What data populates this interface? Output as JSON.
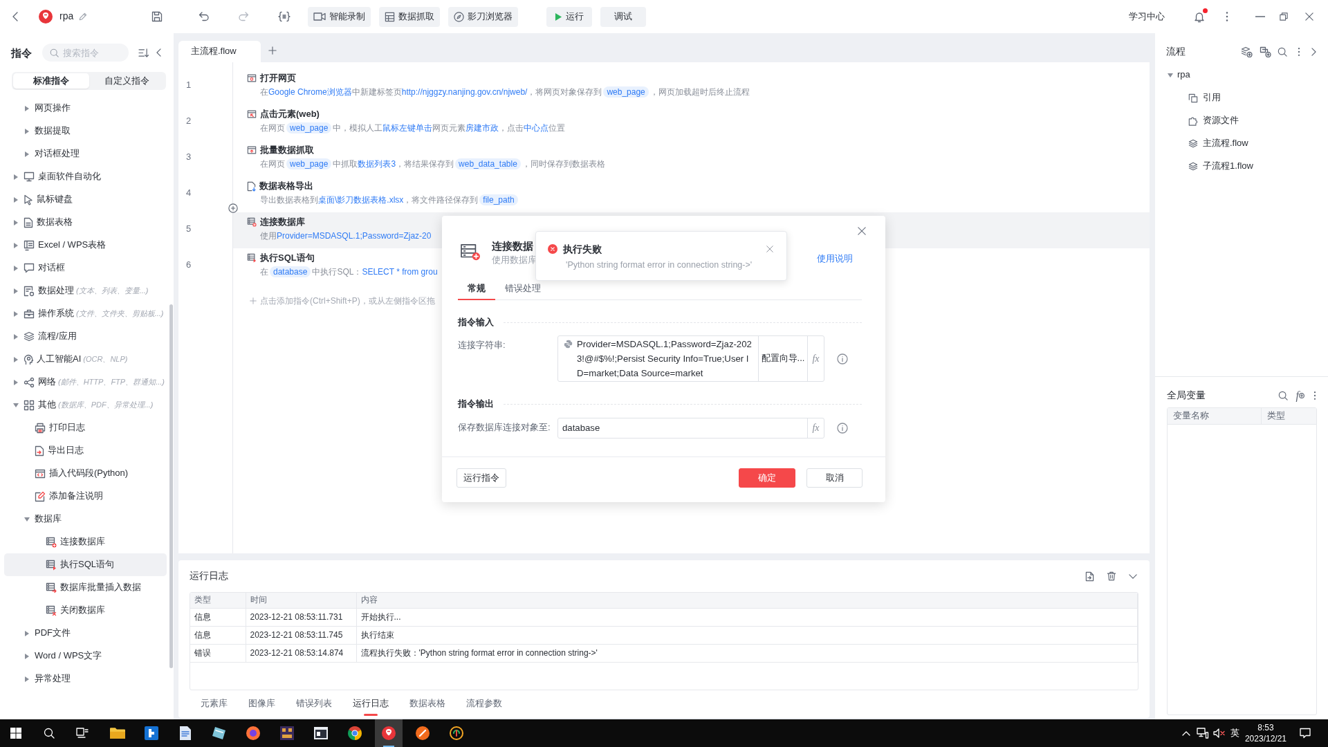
{
  "title_bar": {
    "project_name": "rpa",
    "toolbar_buttons": [
      {
        "label": "智能录制"
      },
      {
        "label": "数据抓取"
      },
      {
        "label": "影刀浏览器"
      },
      {
        "label": "运行"
      },
      {
        "label": "调试"
      }
    ],
    "learning_center": "学习中心",
    "notification": {
      "unread": true
    }
  },
  "commands_panel": {
    "title": "指令",
    "search": {
      "placeholder": "搜索指令"
    },
    "tabs": [
      {
        "label": "标准指令",
        "selected": true
      },
      {
        "label": "自定义指令",
        "selected": false
      }
    ],
    "tree": [
      {
        "children": [
          {
            "kind": "group",
            "label": "网页操作",
            "expanded": false,
            "selected": false
          },
          {
            "kind": "group",
            "label": "数据提取",
            "expanded": false,
            "selected": false
          },
          {
            "kind": "group",
            "label": "对话框处理",
            "expanded": false,
            "selected": false
          }
        ]
      },
      {
        "kind": "group",
        "label": "桌面软件自动化",
        "expanded": false,
        "selected": false
      },
      {
        "kind": "group",
        "label": "鼠标键盘",
        "expanded": false,
        "selected": false
      },
      {
        "kind": "group",
        "label": "数据表格",
        "expanded": false,
        "selected": false
      },
      {
        "kind": "group",
        "label": "Excel / WPS表格",
        "expanded": false,
        "selected": false
      },
      {
        "kind": "group",
        "label": "对话框",
        "expanded": false,
        "selected": false
      },
      {
        "kind": "group",
        "label": "数据处理",
        "hint": "(文本、列表、变量...)",
        "expanded": false,
        "selected": false
      },
      {
        "kind": "group",
        "label": "操作系统",
        "hint": "(文件、文件夹、剪贴板...)",
        "expanded": false,
        "selected": false
      },
      {
        "kind": "group",
        "label": "流程/应用",
        "expanded": false,
        "selected": false
      },
      {
        "kind": "group",
        "label": "人工智能AI",
        "hint": "(OCR、NLP)",
        "expanded": false,
        "selected": false
      },
      {
        "kind": "group",
        "label": "网络",
        "hint": "(邮件、HTTP、FTP、群通知...)",
        "expanded": false,
        "selected": false
      },
      {
        "kind": "group",
        "label": "其他",
        "hint": "(数据库、PDF、异常处理...)",
        "expanded": true,
        "selected": false,
        "children": [
          {
            "kind": "command",
            "label": "打印日志",
            "selected": false
          },
          {
            "kind": "command",
            "label": "导出日志",
            "selected": false
          },
          {
            "kind": "command",
            "label": "插入代码段(Python)",
            "selected": false
          },
          {
            "kind": "command",
            "label": "添加备注说明",
            "selected": false
          },
          {
            "kind": "group",
            "label": "数据库",
            "expanded": true,
            "selected": false,
            "children": [
              {
                "kind": "command",
                "label": "连接数据库",
                "selected": false
              },
              {
                "kind": "command",
                "label": "执行SQL语句",
                "selected": true
              },
              {
                "kind": "command",
                "label": "数据库批量插入数据",
                "selected": false
              },
              {
                "kind": "command",
                "label": "关闭数据库",
                "selected": false
              }
            ]
          },
          {
            "kind": "group",
            "label": "PDF文件",
            "expanded": false,
            "selected": false
          },
          {
            "kind": "group",
            "label": "Word / WPS文字",
            "expanded": false,
            "selected": false
          },
          {
            "kind": "group",
            "label": "异常处理",
            "expanded": false,
            "selected": false
          }
        ]
      }
    ]
  },
  "editor": {
    "tabs": [
      {
        "label": "主流程.flow",
        "selected": true
      }
    ],
    "steps": [
      {
        "number": "1",
        "title": "打开网页",
        "selected": false,
        "description": [
          {
            "kind": "text",
            "text": "在"
          },
          {
            "kind": "value",
            "text": "Google Chrome浏览器"
          },
          {
            "kind": "text",
            "text": "中新建标签页"
          },
          {
            "kind": "value",
            "text": "http://njggzy.nanjing.gov.cn/njweb/"
          },
          {
            "kind": "text",
            "text": "，将网页对象保存到"
          },
          {
            "kind": "variable",
            "text": "web_page"
          },
          {
            "kind": "text",
            "text": "，网页加载超时后终止流程"
          }
        ]
      },
      {
        "number": "2",
        "title": "点击元素(web)",
        "selected": false,
        "description": [
          {
            "kind": "text",
            "text": "在网页"
          },
          {
            "kind": "variable",
            "text": "web_page"
          },
          {
            "kind": "text",
            "text": "中，模拟人工"
          },
          {
            "kind": "value",
            "text": "鼠标左键单击"
          },
          {
            "kind": "text",
            "text": "网页元素"
          },
          {
            "kind": "value",
            "text": "房建市政"
          },
          {
            "kind": "text",
            "text": "，点击"
          },
          {
            "kind": "value",
            "text": "中心点"
          },
          {
            "kind": "text",
            "text": "位置"
          }
        ]
      },
      {
        "number": "3",
        "title": "批量数据抓取",
        "selected": false,
        "description": [
          {
            "kind": "text",
            "text": "在网页"
          },
          {
            "kind": "variable",
            "text": "web_page"
          },
          {
            "kind": "text",
            "text": "中抓取"
          },
          {
            "kind": "value",
            "text": "数据列表3"
          },
          {
            "kind": "text",
            "text": "，将结果保存到"
          },
          {
            "kind": "variable",
            "text": "web_data_table"
          },
          {
            "kind": "text",
            "text": "，同时保存到数据表格"
          }
        ]
      },
      {
        "number": "4",
        "title": "数据表格导出",
        "selected": false,
        "description": [
          {
            "kind": "text",
            "text": "导出数据表格到"
          },
          {
            "kind": "value",
            "text": "桌面\\影刀数据表格.xlsx"
          },
          {
            "kind": "text",
            "text": "，将文件路径保存到"
          },
          {
            "kind": "variable",
            "text": "file_path"
          }
        ]
      },
      {
        "number": "5",
        "title": "连接数据库",
        "selected": true,
        "description": [
          {
            "kind": "text",
            "text": "使用"
          },
          {
            "kind": "value",
            "text": "Provider=MSDASQL.1;Password=Zjaz-20"
          }
        ]
      },
      {
        "number": "6",
        "title": "执行SQL语句",
        "selected": false,
        "description": [
          {
            "kind": "text",
            "text": "在"
          },
          {
            "kind": "variable",
            "text": "database"
          },
          {
            "kind": "text",
            "text": "中执行SQL："
          },
          {
            "kind": "value",
            "text": "SELECT * from grou"
          }
        ]
      }
    ],
    "add_hint": "点击添加指令(Ctrl+Shift+P)，或从左侧指令区拖"
  },
  "run_log": {
    "title": "运行日志",
    "columns": [
      "类型",
      "时间",
      "内容"
    ],
    "rows": [
      [
        "信息",
        "2023-12-21 08:53:11.731",
        "开始执行..."
      ],
      [
        "信息",
        "2023-12-21 08:53:11.745",
        "执行结束"
      ],
      [
        "错误",
        "2023-12-21 08:53:14.874",
        "流程执行失败：'Python string format error in connection string->'"
      ]
    ]
  },
  "bottom_tabs": [
    {
      "label": "元素库",
      "selected": false
    },
    {
      "label": "图像库",
      "selected": false
    },
    {
      "label": "错误列表",
      "selected": false
    },
    {
      "label": "运行日志",
      "selected": true
    },
    {
      "label": "数据表格",
      "selected": false
    },
    {
      "label": "流程参数",
      "selected": false
    }
  ],
  "flow_panel": {
    "title": "流程",
    "tree": [
      {
        "label": "rpa",
        "expanded": true,
        "selected": false,
        "children": [
          {
            "label": "引用",
            "selected": false
          },
          {
            "label": "资源文件",
            "selected": false
          },
          {
            "label": "主流程.flow",
            "selected": false
          },
          {
            "label": "子流程1.flow",
            "selected": false
          }
        ]
      }
    ]
  },
  "global_variables": {
    "title": "全局变量",
    "add_variable_glyph": "f",
    "columns": [
      "变量名称",
      "类型"
    ]
  },
  "dialog": {
    "title": "连接数据",
    "subtitle": "使用数据库",
    "help_link": "使用说明",
    "tabs": [
      {
        "label": "常规",
        "selected": true
      },
      {
        "label": "错误处理",
        "selected": false
      }
    ],
    "sections": [
      {
        "title": "指令输入",
        "fields": [
          {
            "kind": "python",
            "label": "连接字符串:",
            "value": "Provider=MSDASQL.1;Password=Zjaz-2023!@#$%!;Persist Security Info=True;User ID=market;Data Source=market",
            "wizard_button": "配置向导...",
            "expression_button": "fx"
          }
        ]
      },
      {
        "title": "指令输出",
        "fields": [
          {
            "kind": "plain",
            "label": "保存数据库连接对象至:",
            "value": "database",
            "expression_button": "fx"
          }
        ]
      }
    ],
    "buttons": [
      {
        "kind": "run",
        "label": "运行指令"
      },
      {
        "kind": "primary",
        "label": "确定"
      },
      {
        "kind": "default",
        "label": "取消"
      }
    ]
  },
  "toast": {
    "title": "执行失败",
    "message": "'Python string format error in connection string->'"
  },
  "taskbar": {
    "apps": [
      {
        "selected": false
      },
      {
        "selected": false
      },
      {
        "selected": false
      },
      {
        "selected": false
      },
      {
        "selected": false
      },
      {
        "selected": false
      },
      {
        "selected": false
      },
      {
        "selected": false
      },
      {
        "selected": true
      },
      {
        "selected": false
      },
      {
        "selected": false
      }
    ],
    "input_method": "英",
    "time": "8:53",
    "date": "2023/12/21"
  }
}
